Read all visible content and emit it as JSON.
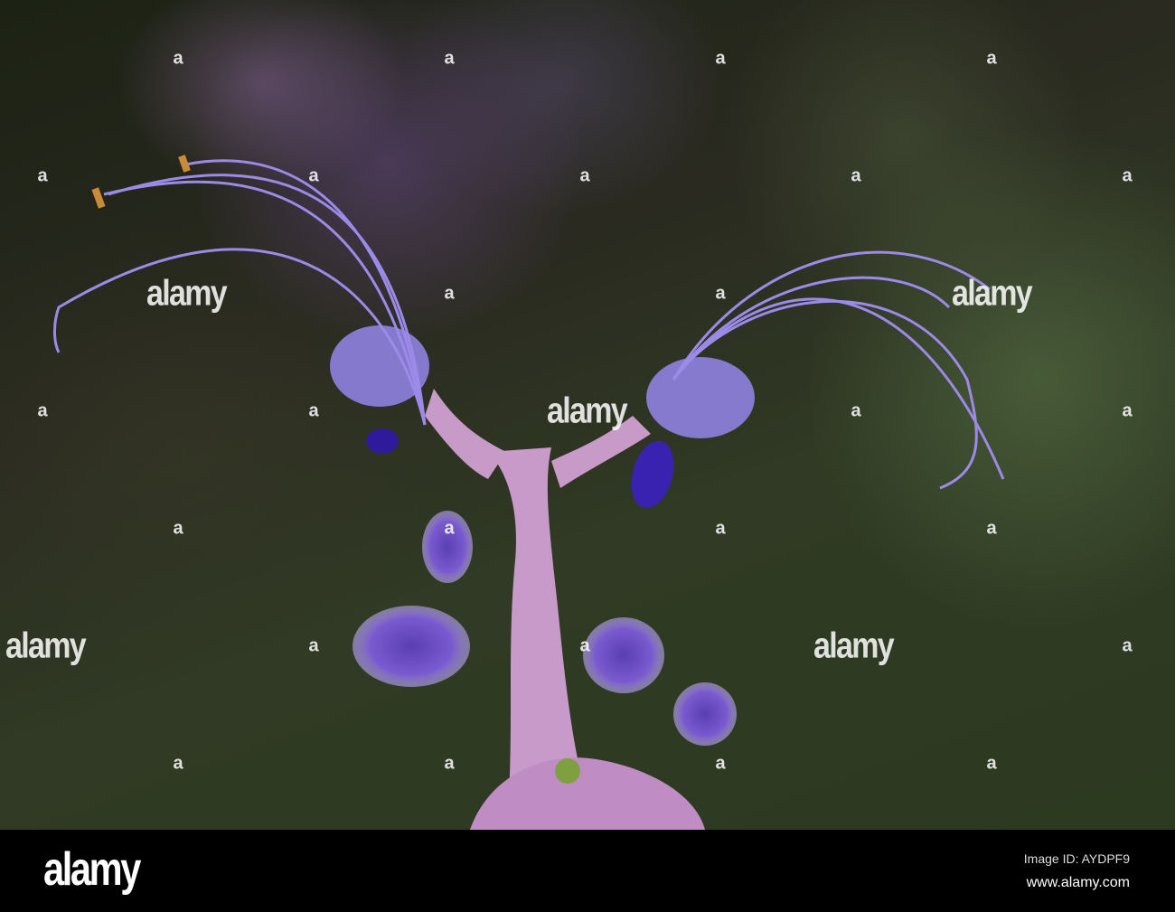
{
  "watermark": {
    "word": "alamy",
    "mark": "a"
  },
  "footer": {
    "logo": "alamy",
    "image_id": "Image ID: AYDPF9",
    "url": "www.alamy.com"
  }
}
